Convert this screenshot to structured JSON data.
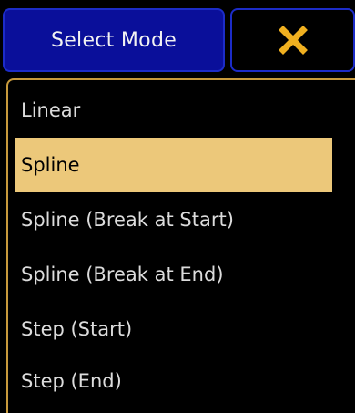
{
  "header": {
    "title": "Select Mode",
    "close_icon": "close-x-icon",
    "close_icon_color": "#f0b020"
  },
  "colors": {
    "title_bg": "#0a0f9a",
    "button_border": "#1c2cc8",
    "frame_border": "#c89a3c",
    "selected_bg": "#ecc87a"
  },
  "options": [
    {
      "label": "Linear",
      "selected": false
    },
    {
      "label": "Spline",
      "selected": true
    },
    {
      "label": "Spline (Break at Start)",
      "selected": false
    },
    {
      "label": "Spline (Break at End)",
      "selected": false
    },
    {
      "label": "Step (Start)",
      "selected": false
    },
    {
      "label": "Step (End)",
      "selected": false
    }
  ]
}
